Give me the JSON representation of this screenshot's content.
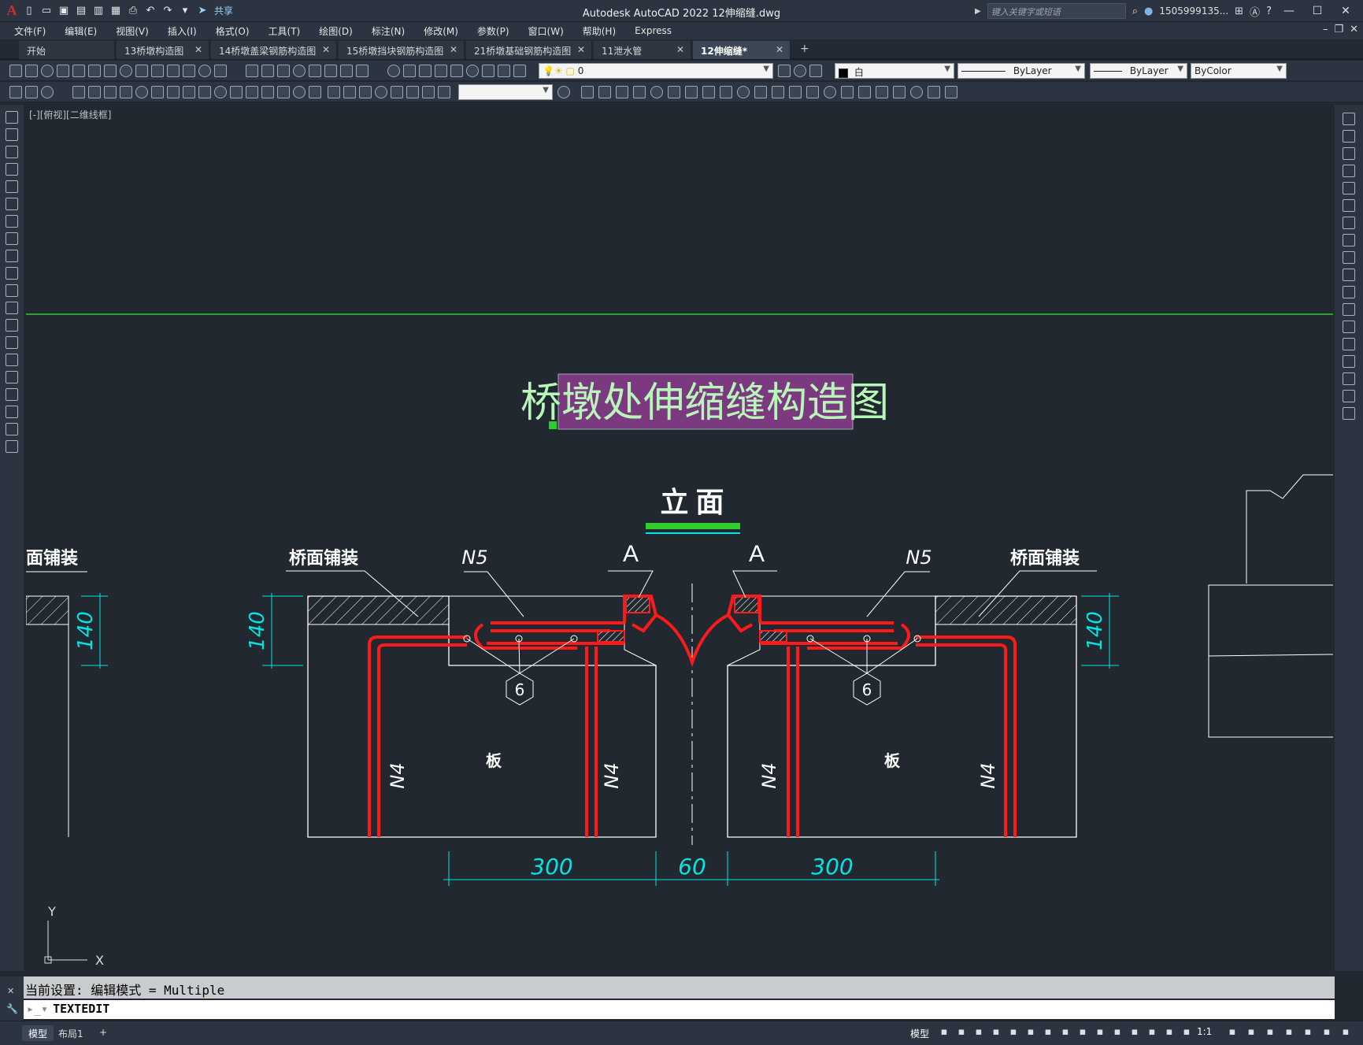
{
  "titlebar": {
    "app_title": "Autodesk AutoCAD 2022    12伸缩缝.dwg",
    "share_label": "共享",
    "search_placeholder": "键入关键字或短语",
    "user_name": "1505999135...",
    "icons": [
      "open-icon",
      "save-icon",
      "saveas-icon",
      "plot-icon",
      "undo-icon",
      "redo-icon",
      "share-icon",
      "search-icon",
      "user-icon",
      "cart-icon",
      "help-icon"
    ]
  },
  "menu": {
    "items": [
      "文件(F)",
      "编辑(E)",
      "视图(V)",
      "插入(I)",
      "格式(O)",
      "工具(T)",
      "绘图(D)",
      "标注(N)",
      "修改(M)",
      "参数(P)",
      "窗口(W)",
      "帮助(H)",
      "Express"
    ]
  },
  "tabs": {
    "items": [
      {
        "label": "开始"
      },
      {
        "label": "13桥墩构造图"
      },
      {
        "label": "14桥墩盖梁钢筋构造图"
      },
      {
        "label": "15桥墩挡块钢筋构造图"
      },
      {
        "label": "21桥墩基础钢筋构造图"
      },
      {
        "label": "11泄水管"
      },
      {
        "label": "12伸缩缝*"
      }
    ],
    "add": "+"
  },
  "properties": {
    "layer": "0",
    "color": "白",
    "linetype": "ByLayer",
    "lineweight": "ByLayer",
    "plotstyle": "ByColor"
  },
  "viewport": {
    "label": "[-][俯视][二维线框]"
  },
  "drawing": {
    "main_title": "桥墩处伸缩缝构造图",
    "section_title": "立  面",
    "left_pavement_cut": "面铺装",
    "left_pavement": "桥面铺装",
    "right_pavement": "桥面铺装",
    "n5_left": "N5",
    "n5_right": "N5",
    "a_left": "A",
    "a_right": "A",
    "n4": "N4",
    "slab": "板",
    "bubble_6": "6",
    "dim_140": "140",
    "dim_300_left": "300",
    "dim_60": "60",
    "dim_300_right": "300",
    "ucs_x": "X",
    "ucs_y": "Y",
    "colors": {
      "rebar": "#ff1a1a",
      "dimension": "#00e5e5",
      "title_bg": "#7b3a80",
      "title_text": "#b8f5b8",
      "green_line": "#2ecc2e",
      "white": "#ffffff"
    }
  },
  "command": {
    "history": "当前设置: 编辑模式 = Multiple",
    "current": "TEXTEDIT"
  },
  "status": {
    "tab_model": "模型",
    "tab_layout": "布局1",
    "tab_add": "+",
    "model_label": "模型",
    "scale": "1:1"
  }
}
